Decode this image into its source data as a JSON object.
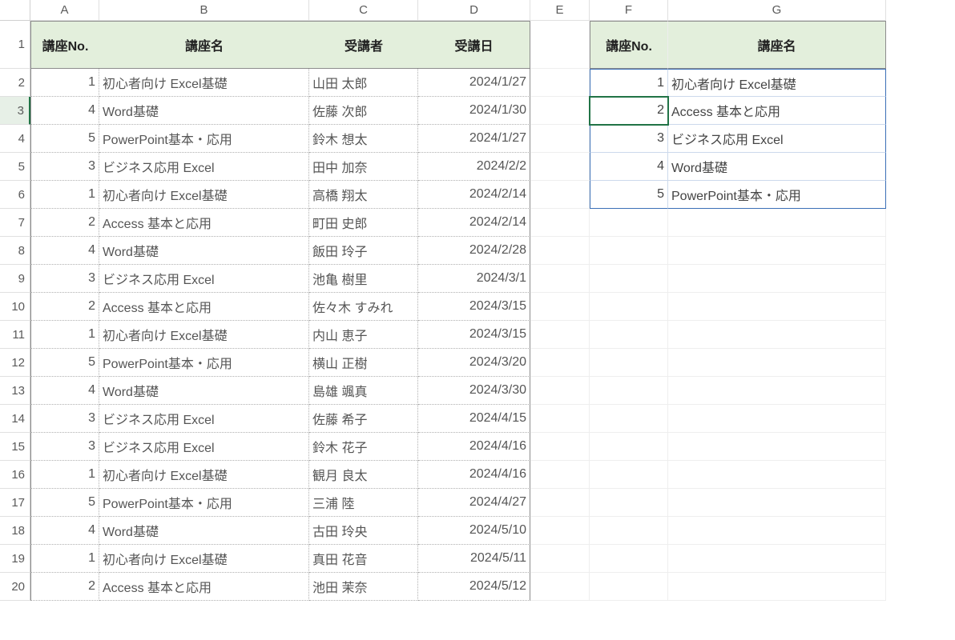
{
  "columns": [
    "A",
    "B",
    "C",
    "D",
    "E",
    "F",
    "G"
  ],
  "rows": [
    1,
    2,
    3,
    4,
    5,
    6,
    7,
    8,
    9,
    10,
    11,
    12,
    13,
    14,
    15,
    16,
    17,
    18,
    19,
    20
  ],
  "selected_row": 3,
  "active_cell": "F3",
  "left_table": {
    "headers": {
      "no": "講座No.",
      "name": "講座名",
      "student": "受講者",
      "date": "受講日"
    },
    "rows": [
      {
        "no": "1",
        "name": "初心者向け Excel基礎",
        "student": "山田 太郎",
        "date": "2024/1/27"
      },
      {
        "no": "4",
        "name": "Word基礎",
        "student": "佐藤 次郎",
        "date": "2024/1/30"
      },
      {
        "no": "5",
        "name": "PowerPoint基本・応用",
        "student": "鈴木 想太",
        "date": "2024/1/27"
      },
      {
        "no": "3",
        "name": "ビジネス応用 Excel",
        "student": "田中 加奈",
        "date": "2024/2/2"
      },
      {
        "no": "1",
        "name": "初心者向け Excel基礎",
        "student": "高橋 翔太",
        "date": "2024/2/14"
      },
      {
        "no": "2",
        "name": "Access 基本と応用",
        "student": "町田 史郎",
        "date": "2024/2/14"
      },
      {
        "no": "4",
        "name": "Word基礎",
        "student": "飯田 玲子",
        "date": "2024/2/28"
      },
      {
        "no": "3",
        "name": "ビジネス応用 Excel",
        "student": "池亀 樹里",
        "date": "2024/3/1"
      },
      {
        "no": "2",
        "name": "Access 基本と応用",
        "student": "佐々木 すみれ",
        "date": "2024/3/15"
      },
      {
        "no": "1",
        "name": "初心者向け Excel基礎",
        "student": "内山 恵子",
        "date": "2024/3/15"
      },
      {
        "no": "5",
        "name": "PowerPoint基本・応用",
        "student": "横山 正樹",
        "date": "2024/3/20"
      },
      {
        "no": "4",
        "name": "Word基礎",
        "student": "島雄 颯真",
        "date": "2024/3/30"
      },
      {
        "no": "3",
        "name": "ビジネス応用 Excel",
        "student": "佐藤 希子",
        "date": "2024/4/15"
      },
      {
        "no": "3",
        "name": "ビジネス応用 Excel",
        "student": "鈴木 花子",
        "date": "2024/4/16"
      },
      {
        "no": "1",
        "name": "初心者向け Excel基礎",
        "student": "観月 良太",
        "date": "2024/4/16"
      },
      {
        "no": "5",
        "name": "PowerPoint基本・応用",
        "student": "三浦 陸",
        "date": "2024/4/27"
      },
      {
        "no": "4",
        "name": "Word基礎",
        "student": "古田 玲央",
        "date": "2024/5/10"
      },
      {
        "no": "1",
        "name": "初心者向け Excel基礎",
        "student": "真田 花音",
        "date": "2024/5/11"
      },
      {
        "no": "2",
        "name": "Access 基本と応用",
        "student": "池田 茉奈",
        "date": "2024/5/12"
      }
    ]
  },
  "right_table": {
    "headers": {
      "no": "講座No.",
      "name": "講座名"
    },
    "rows": [
      {
        "no": "1",
        "name": "初心者向け Excel基礎"
      },
      {
        "no": "2",
        "name": "Access 基本と応用"
      },
      {
        "no": "3",
        "name": "ビジネス応用 Excel"
      },
      {
        "no": "4",
        "name": "Word基礎"
      },
      {
        "no": "5",
        "name": "PowerPoint基本・応用"
      }
    ]
  }
}
